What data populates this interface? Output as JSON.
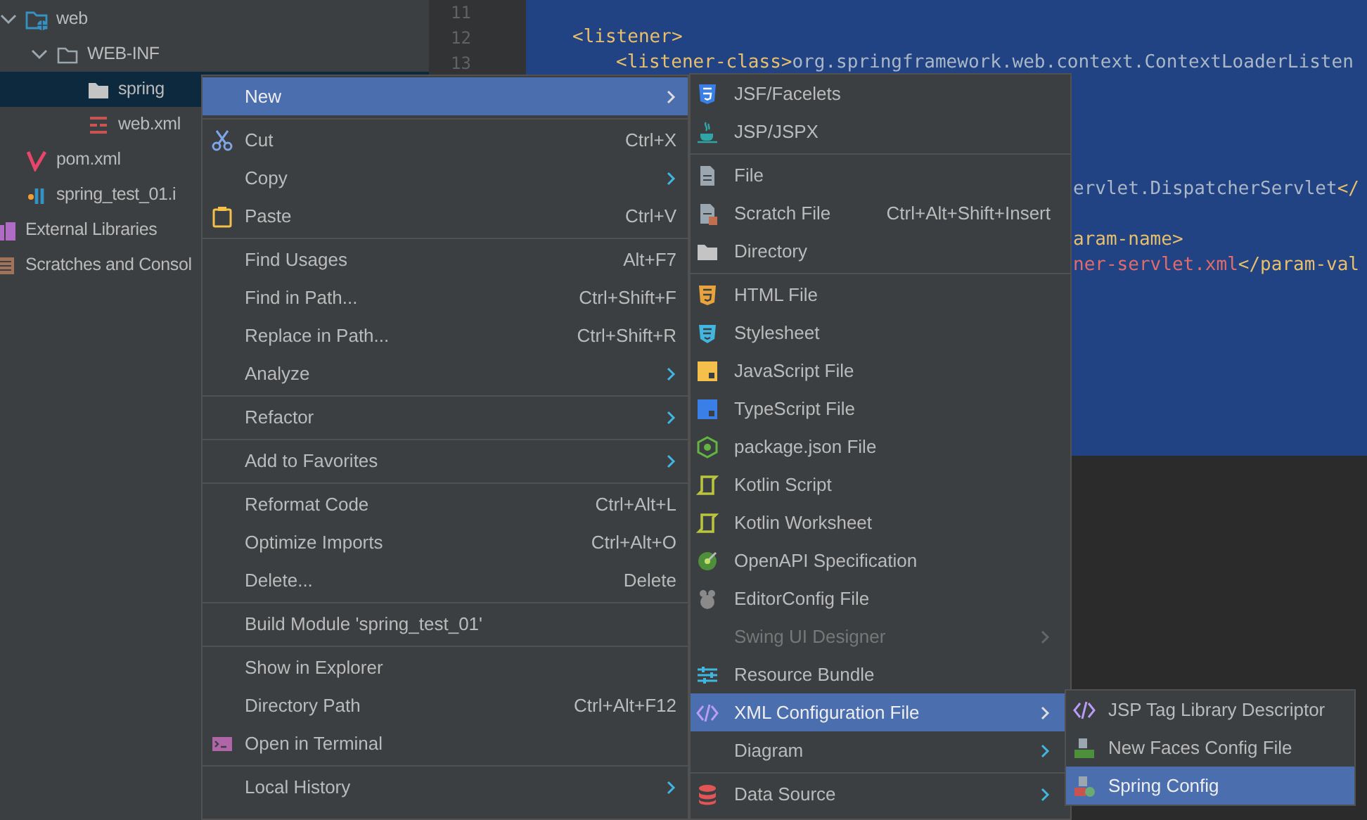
{
  "project_tree": {
    "partial_branch": [
      {
        "label": "web",
        "selected": false,
        "expanded": true,
        "children": [
          {
            "label": "WEB-INF",
            "selected": false,
            "expanded": true,
            "children": [
              {
                "label": "spring",
                "selected": true
              },
              {
                "label": "web.xml",
                "selected": false
              }
            ]
          }
        ]
      },
      {
        "label": "pom.xml",
        "selected": false
      },
      {
        "label": "spring_test_01.i",
        "selected": false
      }
    ],
    "items": [
      {
        "label": "External Libraries",
        "selected": false
      },
      {
        "label": "Scratches and Consol",
        "selected": false
      }
    ]
  },
  "editor": {
    "rows": [
      {
        "number": "11",
        "kind": "blank"
      },
      {
        "number": "12",
        "kind": "indented",
        "segments": [
          {
            "kind": "tag",
            "text": "<listener>"
          }
        ]
      },
      {
        "number": "13",
        "kind": "nested",
        "segments": [
          {
            "kind": "tag",
            "text": "<listener-class>"
          },
          {
            "kind": "text",
            "text": "org.springframework.web.context.ContextLoaderListen"
          }
        ]
      },
      {
        "kind": "covered"
      },
      {
        "kind": "covered"
      },
      {
        "kind": "covered"
      },
      {
        "kind": "covered"
      },
      {
        "kind": "fragment",
        "segments": [
          {
            "kind": "text",
            "text": "ervlet.DispatcherServlet"
          },
          {
            "kind": "tag",
            "text": "</"
          }
        ]
      },
      {
        "kind": "covered"
      },
      {
        "kind": "fragment",
        "segments": [
          {
            "kind": "tag",
            "text": "aram-name>"
          }
        ]
      },
      {
        "kind": "fragment",
        "segments": [
          {
            "kind": "value",
            "text": "ner-servlet.xml"
          },
          {
            "kind": "tag",
            "text": "</param-val"
          }
        ]
      }
    ]
  },
  "context_menu": {
    "items": [
      {
        "kind": "item",
        "label": "New",
        "selected": true,
        "submenu": true
      },
      {
        "kind": "separator"
      },
      {
        "kind": "item",
        "label": "Cut",
        "shortcut": "Ctrl+X",
        "selected": false,
        "submenu": false
      },
      {
        "kind": "item",
        "label": "Copy",
        "selected": false,
        "submenu": true
      },
      {
        "kind": "item",
        "label": "Paste",
        "shortcut": "Ctrl+V",
        "selected": false,
        "submenu": false
      },
      {
        "kind": "separator"
      },
      {
        "kind": "item",
        "label": "Find Usages",
        "shortcut": "Alt+F7",
        "selected": false,
        "submenu": false
      },
      {
        "kind": "item",
        "label": "Find in Path...",
        "shortcut": "Ctrl+Shift+F",
        "selected": false,
        "submenu": false
      },
      {
        "kind": "item",
        "label": "Replace in Path...",
        "shortcut": "Ctrl+Shift+R",
        "selected": false,
        "submenu": false
      },
      {
        "kind": "item",
        "label": "Analyze",
        "selected": false,
        "submenu": true
      },
      {
        "kind": "separator"
      },
      {
        "kind": "item",
        "label": "Refactor",
        "selected": false,
        "submenu": true
      },
      {
        "kind": "separator"
      },
      {
        "kind": "item",
        "label": "Add to Favorites",
        "selected": false,
        "submenu": true
      },
      {
        "kind": "separator"
      },
      {
        "kind": "item",
        "label": "Reformat Code",
        "shortcut": "Ctrl+Alt+L",
        "selected": false,
        "submenu": false
      },
      {
        "kind": "item",
        "label": "Optimize Imports",
        "shortcut": "Ctrl+Alt+O",
        "selected": false,
        "submenu": false
      },
      {
        "kind": "item",
        "label": "Delete...",
        "shortcut": "Delete",
        "selected": false,
        "submenu": false
      },
      {
        "kind": "separator"
      },
      {
        "kind": "item",
        "label": "Build Module 'spring_test_01'",
        "selected": false,
        "submenu": false
      },
      {
        "kind": "separator"
      },
      {
        "kind": "item",
        "label": "Show in Explorer",
        "selected": false,
        "submenu": false
      },
      {
        "kind": "item",
        "label": "Directory Path",
        "shortcut": "Ctrl+Alt+F12",
        "selected": false,
        "submenu": false
      },
      {
        "kind": "item",
        "label": "Open in Terminal",
        "selected": false,
        "submenu": false
      },
      {
        "kind": "separator"
      },
      {
        "kind": "item",
        "label": "Local History",
        "selected": false,
        "submenu": true
      }
    ]
  },
  "new_submenu": {
    "items": [
      {
        "kind": "item",
        "label": "JSF/Facelets",
        "selected": false,
        "disabled": false,
        "submenu": false
      },
      {
        "kind": "item",
        "label": "JSP/JSPX",
        "selected": false,
        "disabled": false,
        "submenu": false
      },
      {
        "kind": "separator"
      },
      {
        "kind": "item",
        "label": "File",
        "selected": false,
        "disabled": false,
        "submenu": false
      },
      {
        "kind": "item",
        "label": "Scratch File",
        "shortcut": "Ctrl+Alt+Shift+Insert",
        "selected": false,
        "disabled": false,
        "submenu": false
      },
      {
        "kind": "item",
        "label": "Directory",
        "selected": false,
        "disabled": false,
        "submenu": false
      },
      {
        "kind": "separator"
      },
      {
        "kind": "item",
        "label": "HTML File",
        "selected": false,
        "disabled": false,
        "submenu": false
      },
      {
        "kind": "item",
        "label": "Stylesheet",
        "selected": false,
        "disabled": false,
        "submenu": false
      },
      {
        "kind": "item",
        "label": "JavaScript File",
        "selected": false,
        "disabled": false,
        "submenu": false
      },
      {
        "kind": "item",
        "label": "TypeScript File",
        "selected": false,
        "disabled": false,
        "submenu": false
      },
      {
        "kind": "item",
        "label": "package.json File",
        "selected": false,
        "disabled": false,
        "submenu": false
      },
      {
        "kind": "item",
        "label": "Kotlin Script",
        "selected": false,
        "disabled": false,
        "submenu": false
      },
      {
        "kind": "item",
        "label": "Kotlin Worksheet",
        "selected": false,
        "disabled": false,
        "submenu": false
      },
      {
        "kind": "item",
        "label": "OpenAPI Specification",
        "selected": false,
        "disabled": false,
        "submenu": false
      },
      {
        "kind": "item",
        "label": "EditorConfig File",
        "selected": false,
        "disabled": false,
        "submenu": false
      },
      {
        "kind": "item",
        "label": "Swing UI Designer",
        "selected": false,
        "disabled": true,
        "submenu": true
      },
      {
        "kind": "item",
        "label": "Resource Bundle",
        "selected": false,
        "disabled": false,
        "submenu": false
      },
      {
        "kind": "item",
        "label": "XML Configuration File",
        "selected": true,
        "disabled": false,
        "submenu": true
      },
      {
        "kind": "item",
        "label": "Diagram",
        "selected": false,
        "disabled": false,
        "submenu": true
      },
      {
        "kind": "separator"
      },
      {
        "kind": "item",
        "label": "Data Source",
        "selected": false,
        "disabled": false,
        "submenu": true
      }
    ]
  },
  "xml_submenu": {
    "items": [
      {
        "kind": "item",
        "label": "JSP Tag Library Descriptor",
        "selected": false
      },
      {
        "kind": "item",
        "label": "New Faces Config File",
        "selected": false
      },
      {
        "kind": "item",
        "label": "Spring Config",
        "selected": true
      }
    ]
  }
}
